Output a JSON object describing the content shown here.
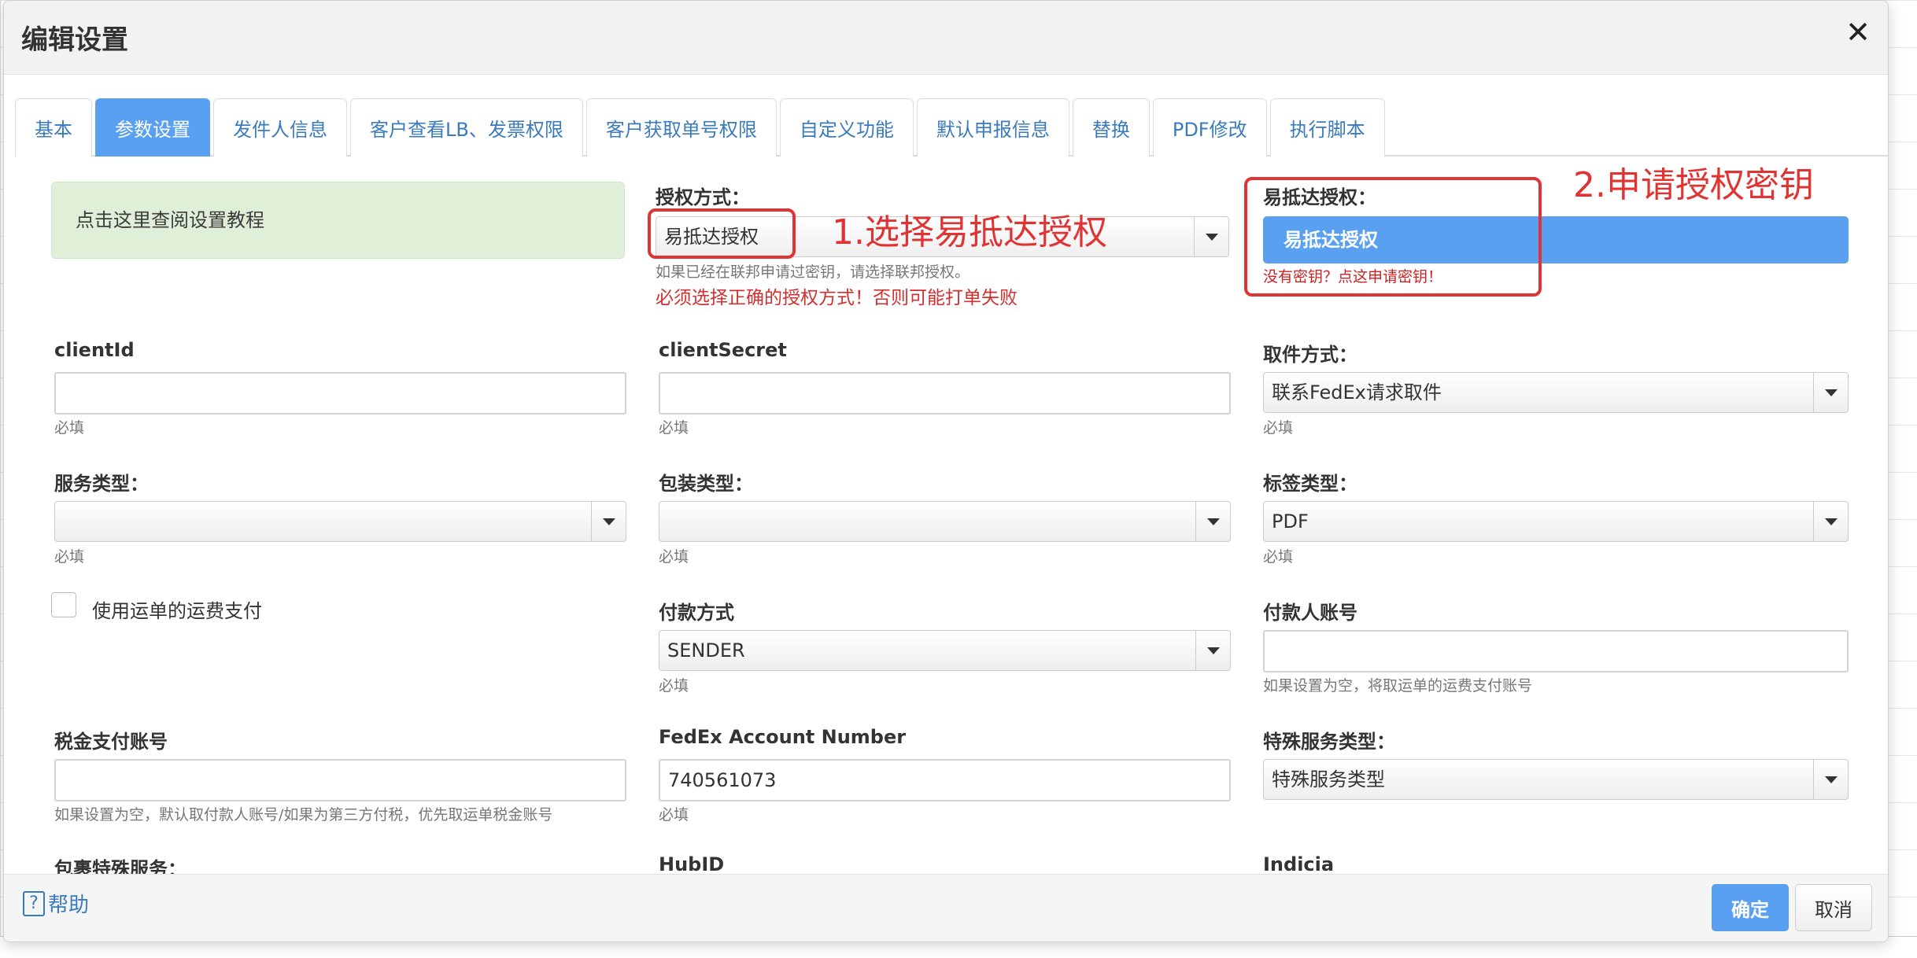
{
  "dialog": {
    "title": "编辑设置"
  },
  "tabs": [
    {
      "label": "基本"
    },
    {
      "label": "参数设置"
    },
    {
      "label": "发件人信息"
    },
    {
      "label": "客户查看LB、发票权限"
    },
    {
      "label": "客户获取单号权限"
    },
    {
      "label": "自定义功能"
    },
    {
      "label": "默认申报信息"
    },
    {
      "label": "替换"
    },
    {
      "label": "PDF修改"
    },
    {
      "label": "执行脚本"
    }
  ],
  "tutorial_link": "点击这里查阅设置教程",
  "auth": {
    "label": "授权方式：",
    "value": "易抵达授权",
    "help": "如果已经在联邦申请过密钥，请选择联邦授权。",
    "warning": "必须选择正确的授权方式！否则可能打单失败"
  },
  "yidida": {
    "label": "易抵达授权：",
    "button": "易抵达授权",
    "link": "没有密钥？点这申请密钥！"
  },
  "annotations": {
    "step1": "1.选择易抵达授权",
    "step2": "2.申请授权密钥"
  },
  "fields": {
    "required": "必填",
    "client_id": {
      "label": "clientId",
      "value": ""
    },
    "client_secret": {
      "label": "clientSecret",
      "value": ""
    },
    "pickup": {
      "label": "取件方式：",
      "value": "联系FedEx请求取件"
    },
    "service_type": {
      "label": "服务类型：",
      "value": ""
    },
    "packaging_type": {
      "label": "包装类型：",
      "value": ""
    },
    "label_type": {
      "label": "标签类型：",
      "value": "PDF"
    },
    "use_waybill_freight": {
      "label": "使用运单的运费支付"
    },
    "payment_method": {
      "label": "付款方式",
      "value": "SENDER"
    },
    "payer_account": {
      "label": "付款人账号",
      "value": "",
      "help": "如果设置为空，将取运单的运费支付账号"
    },
    "tax_account": {
      "label": "税金支付账号",
      "value": "",
      "help": "如果设置为空，默认取付款人账号/如果为第三方付税，优先取运单税金账号"
    },
    "fedex_account": {
      "label": "FedEx Account Number",
      "value": "740561073"
    },
    "special_service_type": {
      "label": "特殊服务类型：",
      "value": "特殊服务类型"
    },
    "package_special_service": {
      "label": "包裹特殊服务："
    },
    "hub_id": {
      "label": "HubID"
    },
    "indicia": {
      "label": "Indicia"
    }
  },
  "footer": {
    "help": "帮助",
    "ok": "确定",
    "cancel": "取消"
  }
}
